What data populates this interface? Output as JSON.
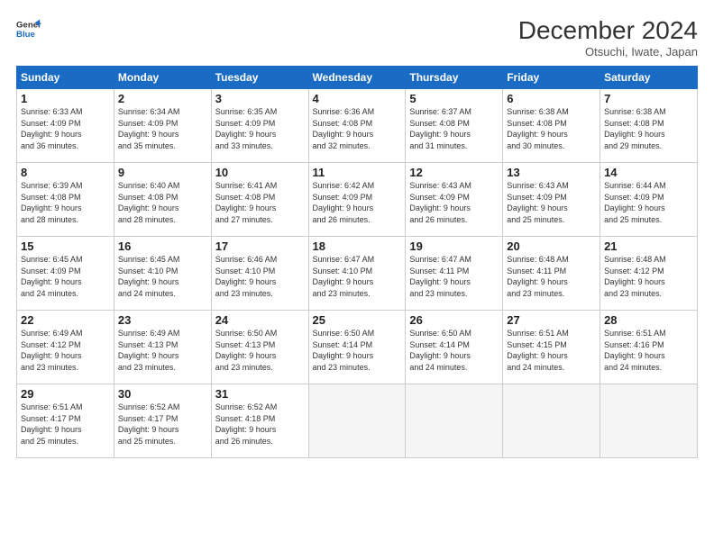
{
  "logo": {
    "line1": "General",
    "line2": "Blue"
  },
  "header": {
    "title": "December 2024",
    "subtitle": "Otsuchi, Iwate, Japan"
  },
  "weekdays": [
    "Sunday",
    "Monday",
    "Tuesday",
    "Wednesday",
    "Thursday",
    "Friday",
    "Saturday"
  ],
  "weeks": [
    [
      {
        "day": 1,
        "sunrise": "6:33 AM",
        "sunset": "4:09 PM",
        "daylight": "9 hours and 36 minutes."
      },
      {
        "day": 2,
        "sunrise": "6:34 AM",
        "sunset": "4:09 PM",
        "daylight": "9 hours and 35 minutes."
      },
      {
        "day": 3,
        "sunrise": "6:35 AM",
        "sunset": "4:09 PM",
        "daylight": "9 hours and 33 minutes."
      },
      {
        "day": 4,
        "sunrise": "6:36 AM",
        "sunset": "4:08 PM",
        "daylight": "9 hours and 32 minutes."
      },
      {
        "day": 5,
        "sunrise": "6:37 AM",
        "sunset": "4:08 PM",
        "daylight": "9 hours and 31 minutes."
      },
      {
        "day": 6,
        "sunrise": "6:38 AM",
        "sunset": "4:08 PM",
        "daylight": "9 hours and 30 minutes."
      },
      {
        "day": 7,
        "sunrise": "6:38 AM",
        "sunset": "4:08 PM",
        "daylight": "9 hours and 29 minutes."
      }
    ],
    [
      {
        "day": 8,
        "sunrise": "6:39 AM",
        "sunset": "4:08 PM",
        "daylight": "9 hours and 28 minutes."
      },
      {
        "day": 9,
        "sunrise": "6:40 AM",
        "sunset": "4:08 PM",
        "daylight": "9 hours and 28 minutes."
      },
      {
        "day": 10,
        "sunrise": "6:41 AM",
        "sunset": "4:08 PM",
        "daylight": "9 hours and 27 minutes."
      },
      {
        "day": 11,
        "sunrise": "6:42 AM",
        "sunset": "4:09 PM",
        "daylight": "9 hours and 26 minutes."
      },
      {
        "day": 12,
        "sunrise": "6:43 AM",
        "sunset": "4:09 PM",
        "daylight": "9 hours and 26 minutes."
      },
      {
        "day": 13,
        "sunrise": "6:43 AM",
        "sunset": "4:09 PM",
        "daylight": "9 hours and 25 minutes."
      },
      {
        "day": 14,
        "sunrise": "6:44 AM",
        "sunset": "4:09 PM",
        "daylight": "9 hours and 25 minutes."
      }
    ],
    [
      {
        "day": 15,
        "sunrise": "6:45 AM",
        "sunset": "4:09 PM",
        "daylight": "9 hours and 24 minutes."
      },
      {
        "day": 16,
        "sunrise": "6:45 AM",
        "sunset": "4:10 PM",
        "daylight": "9 hours and 24 minutes."
      },
      {
        "day": 17,
        "sunrise": "6:46 AM",
        "sunset": "4:10 PM",
        "daylight": "9 hours and 23 minutes."
      },
      {
        "day": 18,
        "sunrise": "6:47 AM",
        "sunset": "4:10 PM",
        "daylight": "9 hours and 23 minutes."
      },
      {
        "day": 19,
        "sunrise": "6:47 AM",
        "sunset": "4:11 PM",
        "daylight": "9 hours and 23 minutes."
      },
      {
        "day": 20,
        "sunrise": "6:48 AM",
        "sunset": "4:11 PM",
        "daylight": "9 hours and 23 minutes."
      },
      {
        "day": 21,
        "sunrise": "6:48 AM",
        "sunset": "4:12 PM",
        "daylight": "9 hours and 23 minutes."
      }
    ],
    [
      {
        "day": 22,
        "sunrise": "6:49 AM",
        "sunset": "4:12 PM",
        "daylight": "9 hours and 23 minutes."
      },
      {
        "day": 23,
        "sunrise": "6:49 AM",
        "sunset": "4:13 PM",
        "daylight": "9 hours and 23 minutes."
      },
      {
        "day": 24,
        "sunrise": "6:50 AM",
        "sunset": "4:13 PM",
        "daylight": "9 hours and 23 minutes."
      },
      {
        "day": 25,
        "sunrise": "6:50 AM",
        "sunset": "4:14 PM",
        "daylight": "9 hours and 23 minutes."
      },
      {
        "day": 26,
        "sunrise": "6:50 AM",
        "sunset": "4:14 PM",
        "daylight": "9 hours and 24 minutes."
      },
      {
        "day": 27,
        "sunrise": "6:51 AM",
        "sunset": "4:15 PM",
        "daylight": "9 hours and 24 minutes."
      },
      {
        "day": 28,
        "sunrise": "6:51 AM",
        "sunset": "4:16 PM",
        "daylight": "9 hours and 24 minutes."
      }
    ],
    [
      {
        "day": 29,
        "sunrise": "6:51 AM",
        "sunset": "4:17 PM",
        "daylight": "9 hours and 25 minutes."
      },
      {
        "day": 30,
        "sunrise": "6:52 AM",
        "sunset": "4:17 PM",
        "daylight": "9 hours and 25 minutes."
      },
      {
        "day": 31,
        "sunrise": "6:52 AM",
        "sunset": "4:18 PM",
        "daylight": "9 hours and 26 minutes."
      },
      null,
      null,
      null,
      null
    ]
  ]
}
